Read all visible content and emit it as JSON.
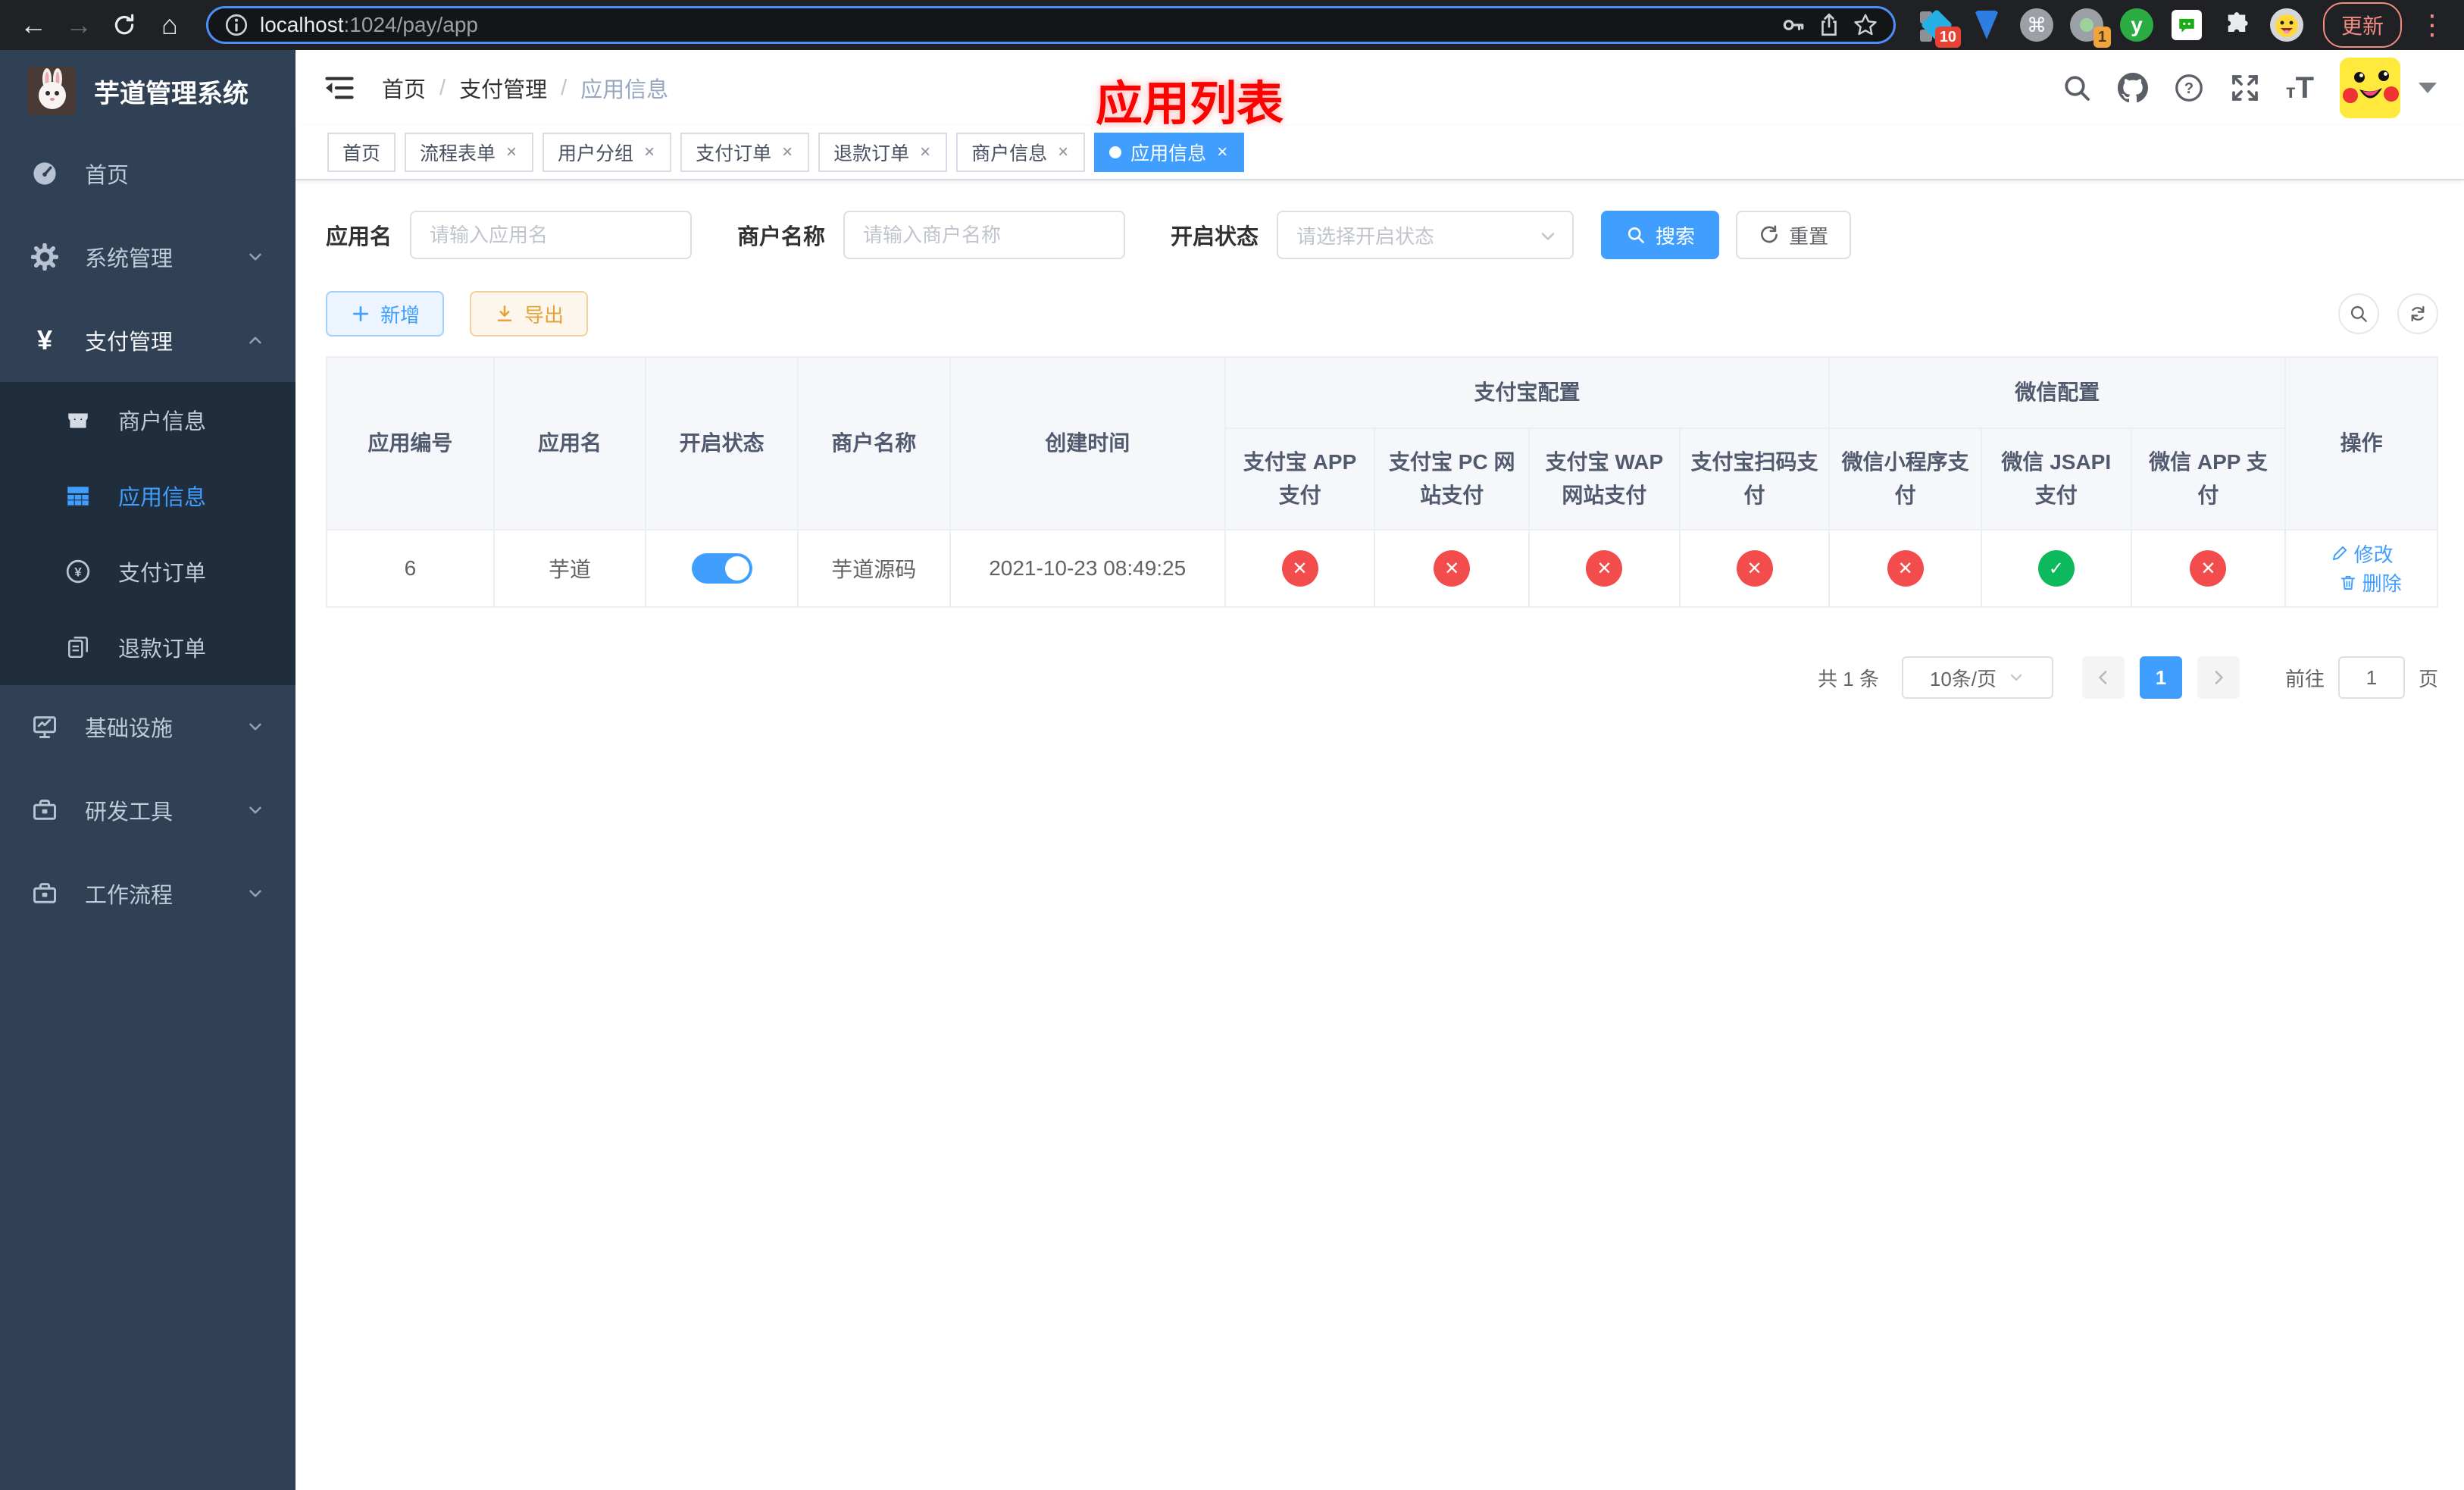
{
  "browser": {
    "url_host": "localhost",
    "url_rest": ":1024/pay/app",
    "update_label": "更新",
    "ext_badge_diamond": "10",
    "ext_badge_circle": "1",
    "ext_y_label": "y"
  },
  "icons": {
    "back": "←",
    "forward": "→",
    "home": "⌂",
    "command": "⌘",
    "more": "⋮",
    "close": "×",
    "check": "✓",
    "cross": "✕"
  },
  "sidebar": {
    "title": "芋道管理系统",
    "items": [
      {
        "label": "首页"
      },
      {
        "label": "系统管理"
      },
      {
        "label": "支付管理"
      },
      {
        "label": "基础设施"
      },
      {
        "label": "研发工具"
      },
      {
        "label": "工作流程"
      }
    ],
    "submenu": [
      {
        "label": "商户信息"
      },
      {
        "label": "应用信息"
      },
      {
        "label": "支付订单"
      },
      {
        "label": "退款订单"
      }
    ]
  },
  "header": {
    "breadcrumb": [
      "首页",
      "支付管理",
      "应用信息"
    ],
    "overlay_title": "应用列表"
  },
  "tabs": [
    {
      "label": "首页"
    },
    {
      "label": "流程表单"
    },
    {
      "label": "用户分组"
    },
    {
      "label": "支付订单"
    },
    {
      "label": "退款订单"
    },
    {
      "label": "商户信息"
    },
    {
      "label": "应用信息"
    }
  ],
  "filters": {
    "app_name_label": "应用名",
    "app_name_placeholder": "请输入应用名",
    "merchant_label": "商户名称",
    "merchant_placeholder": "请输入商户名称",
    "status_label": "开启状态",
    "status_placeholder": "请选择开启状态",
    "search_label": "搜索",
    "reset_label": "重置"
  },
  "toolbar": {
    "add_label": "新增",
    "export_label": "导出"
  },
  "table": {
    "columns": {
      "id": "应用编号",
      "name": "应用名",
      "status": "开启状态",
      "merchant": "商户名称",
      "created": "创建时间",
      "group_alipay": "支付宝配置",
      "group_wechat": "微信配置",
      "alipay": [
        "支付宝 APP 支付",
        "支付宝 PC 网站支付",
        "支付宝 WAP 网站支付",
        "支付宝扫码支付"
      ],
      "wechat": [
        "微信小程序支付",
        "微信 JSAPI 支付",
        "微信 APP 支付"
      ],
      "ops": "操作"
    },
    "row": {
      "id": "6",
      "name": "芋道",
      "enabled": true,
      "merchant": "芋道源码",
      "created": "2021-10-23 08:49:25",
      "channels": [
        false,
        false,
        false,
        false,
        false,
        true,
        false
      ],
      "edit_label": "修改",
      "delete_label": "删除"
    }
  },
  "pagination": {
    "total_text": "共 1 条",
    "page_size": "10条/页",
    "current_page": "1",
    "goto_label": "前往",
    "goto_value": "1",
    "page_suffix": "页"
  },
  "colors": {
    "accent": "#409eff",
    "sidebar_bg": "#304156",
    "submenu_bg": "#1f2d3d",
    "fail": "#f34c4c",
    "success": "#0cb95c",
    "warning": "#e6a23c",
    "annotation_red": "#fb0300"
  }
}
